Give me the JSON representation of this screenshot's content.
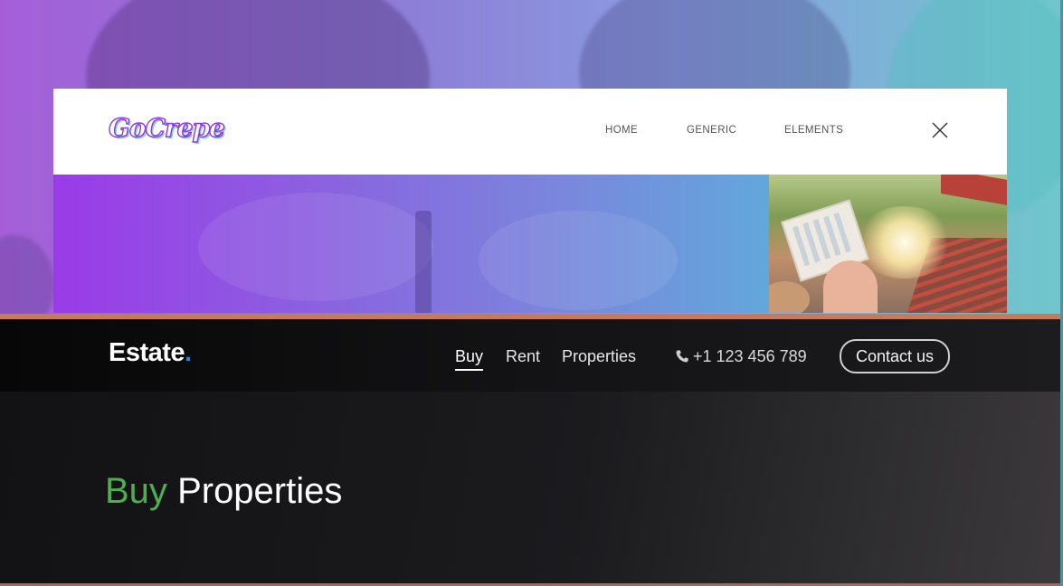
{
  "gocrepe": {
    "logo_text": "GoCrepe",
    "nav": {
      "home": "HOME",
      "generic": "GENERIC",
      "elements": "ELEMENTS"
    },
    "close_icon": "close-icon"
  },
  "estate": {
    "brand_text": "Estate",
    "brand_dot": ".",
    "nav": {
      "buy": "Buy",
      "rent": "Rent",
      "properties": "Properties"
    },
    "phone": "+1 123 456 789",
    "phone_icon": "phone-icon",
    "contact_label": "Contact us",
    "heading_accent": "Buy",
    "heading_rest": "Properties"
  },
  "colors": {
    "accent_green": "#4caf50",
    "brand_dot_blue": "#1e88e5",
    "divider": "#c87a58"
  }
}
